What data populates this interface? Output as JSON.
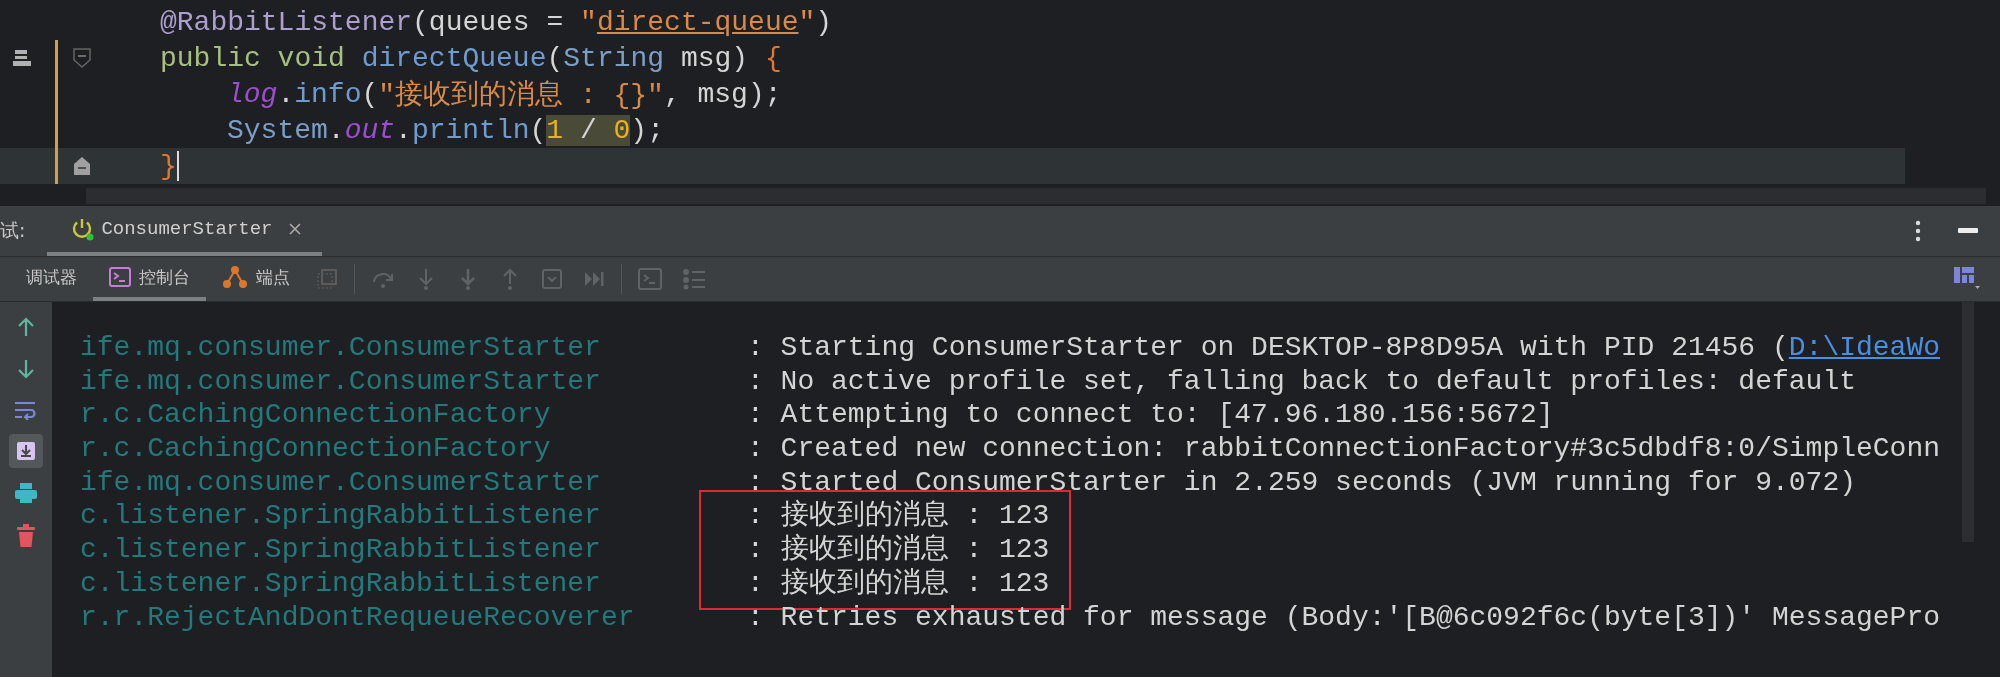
{
  "editor": {
    "lines": [
      {
        "kind": "annotation",
        "current": false,
        "tokens": [
          {
            "text": "@RabbitListener",
            "kind": "annotation"
          },
          {
            "text": "(queues = ",
            "kind": "plain"
          },
          {
            "text": "\"",
            "kind": "string"
          },
          {
            "text": "direct-queue",
            "kind": "string-link"
          },
          {
            "text": "\"",
            "kind": "string"
          },
          {
            "text": ")",
            "kind": "plain"
          }
        ]
      },
      {
        "kind": "signature",
        "current": false,
        "tokens": [
          {
            "text": "public void ",
            "kind": "keyword"
          },
          {
            "text": "directQueue",
            "kind": "method"
          },
          {
            "text": "(",
            "kind": "plain"
          },
          {
            "text": "String",
            "kind": "type"
          },
          {
            "text": " msg) ",
            "kind": "plain"
          },
          {
            "text": "{",
            "kind": "brace"
          }
        ]
      },
      {
        "kind": "body",
        "current": false,
        "tokens": [
          {
            "text": "log",
            "kind": "static-field"
          },
          {
            "text": ".",
            "kind": "plain"
          },
          {
            "text": "info",
            "kind": "method"
          },
          {
            "text": "(",
            "kind": "plain"
          },
          {
            "text": "\"接收到的消息 : {}\"",
            "kind": "string"
          },
          {
            "text": ", msg);",
            "kind": "plain"
          }
        ]
      },
      {
        "kind": "body",
        "current": false,
        "tokens": [
          {
            "text": "System",
            "kind": "type"
          },
          {
            "text": ".",
            "kind": "plain"
          },
          {
            "text": "out",
            "kind": "static-field"
          },
          {
            "text": ".",
            "kind": "plain"
          },
          {
            "text": "println",
            "kind": "method"
          },
          {
            "text": "(",
            "kind": "plain"
          },
          {
            "text": "1",
            "kind": "number-hl"
          },
          {
            "text": " / ",
            "kind": "operator-hl"
          },
          {
            "text": "0",
            "kind": "number-hl"
          },
          {
            "text": ");",
            "kind": "plain"
          }
        ]
      },
      {
        "kind": "close",
        "current": true,
        "tokens": [
          {
            "text": "}",
            "kind": "brace"
          }
        ]
      }
    ]
  },
  "run_panel": {
    "prefix": "试:",
    "run_tabs": [
      {
        "label": "ConsumerStarter",
        "selected": true
      }
    ],
    "tool_tabs": [
      {
        "label": "调试器",
        "kind": "debugger",
        "selected": false
      },
      {
        "label": "控制台",
        "kind": "console",
        "selected": true
      },
      {
        "label": "端点",
        "kind": "breakpoints",
        "selected": false
      }
    ]
  },
  "console": {
    "lines": [
      {
        "logger": "ife.mq.consumer.ConsumerStarter",
        "message": ": Starting ConsumerStarter on DESKTOP-8P8D95A with PID 21456 (",
        "link": "D:\\IdeaWo",
        "boxed": false
      },
      {
        "logger": "ife.mq.consumer.ConsumerStarter",
        "message": ": No active profile set, falling back to default profiles: default",
        "boxed": false
      },
      {
        "logger": "r.c.CachingConnectionFactory",
        "message": ": Attempting to connect to: [47.96.180.156:5672]",
        "boxed": false
      },
      {
        "logger": "r.c.CachingConnectionFactory",
        "message": ": Created new connection: rabbitConnectionFactory#3c5dbdf8:0/SimpleConn",
        "boxed": false
      },
      {
        "logger": "ife.mq.consumer.ConsumerStarter",
        "message": ": Started ConsumerStarter in 2.259 seconds (JVM running for 9.072)",
        "boxed": false
      },
      {
        "logger": "c.listener.SpringRabbitListener",
        "message": ": 接收到的消息 : 123",
        "boxed": true
      },
      {
        "logger": "c.listener.SpringRabbitListener",
        "message": ": 接收到的消息 : 123",
        "boxed": true
      },
      {
        "logger": "c.listener.SpringRabbitListener",
        "message": ": 接收到的消息 : 123",
        "boxed": true
      },
      {
        "logger": "r.r.RejectAndDontRequeueRecoverer",
        "message": ": Retries exhausted for message (Body:'[B@6c092f6c(byte[3])' MessagePro",
        "boxed": false
      }
    ]
  }
}
